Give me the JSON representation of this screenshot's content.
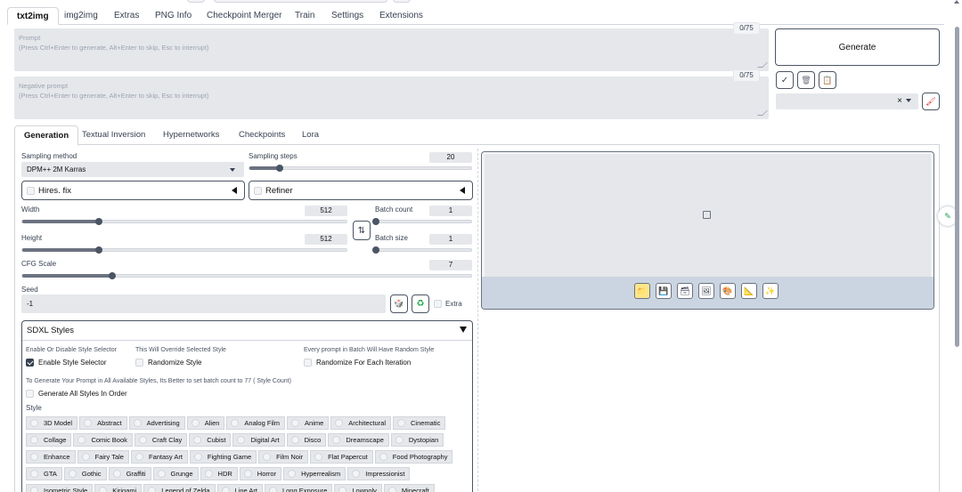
{
  "tabs": [
    "txt2img",
    "img2img",
    "Extras",
    "PNG Info",
    "Checkpoint Merger",
    "Train",
    "Settings",
    "Extensions"
  ],
  "prompt": {
    "label": "Prompt",
    "hint": "(Press Ctrl+Enter to generate, Alt+Enter to skip, Esc to interrupt)",
    "counter": "0/75"
  },
  "negative": {
    "label": "Negative prompt",
    "hint": "(Press Ctrl+Enter to generate, Alt+Enter to skip, Esc to interrupt)",
    "counter": "0/75"
  },
  "generate_label": "Generate",
  "tool_icons": {
    "check": "✓",
    "trash": "🗑",
    "clipboard": "📋",
    "clear": "×",
    "paint": "🖌"
  },
  "subtabs": [
    "Generation",
    "Textual Inversion",
    "Hypernetworks",
    "Checkpoints",
    "Lora"
  ],
  "sampling": {
    "method_label": "Sampling method",
    "method_value": "DPM++ 2M Karras",
    "steps_label": "Sampling steps",
    "steps_value": "20",
    "steps_fraction": 0.135
  },
  "hires_label": "Hires. fix",
  "refiner_label": "Refiner",
  "width": {
    "label": "Width",
    "value": "512",
    "fraction": 0.235
  },
  "height": {
    "label": "Height",
    "value": "512",
    "fraction": 0.235
  },
  "swap_icon": "⇅",
  "batch_count": {
    "label": "Batch count",
    "value": "1",
    "fraction": 0.0
  },
  "batch_size": {
    "label": "Batch size",
    "value": "1",
    "fraction": 0.0
  },
  "cfg": {
    "label": "CFG Scale",
    "value": "7",
    "fraction": 0.2
  },
  "seed": {
    "label": "Seed",
    "value": "-1",
    "extra_label": "Extra"
  },
  "sdxl": {
    "title": "SDXL Styles",
    "enable_caption": "Enable Or Disable Style Selector",
    "enable_label": "Enable Style Selector",
    "override_caption": "This Will Override Selected Style",
    "randomize_label": "Randomize Style",
    "batch_caption": "Every prompt in Batch Will Have Random Style",
    "randomize_each_label": "Randomize For Each Iteration",
    "all_caption": "To Generate Your Prompt in All Available Styles, Its Better to set batch count to 77 ( Style Count)",
    "all_label": "Generate All Styles In Order",
    "style_label": "Style",
    "styles": [
      [
        "3D Model",
        "Abstract",
        "Advertising",
        "Alien",
        "Analog Film",
        "Anime",
        "Architectural",
        "Cinematic"
      ],
      [
        "Collage",
        "Comic Book",
        "Craft Clay",
        "Cubist",
        "Digital Art",
        "Disco",
        "Dreamscape",
        "Dystopian"
      ],
      [
        "Enhance",
        "Fairy Tale",
        "Fantasy Art",
        "Fighting Game",
        "Film Noir",
        "Flat Papercut",
        "Food Photography"
      ],
      [
        "GTA",
        "Gothic",
        "Graffiti",
        "Grunge",
        "HDR",
        "Horror",
        "Hyperrealism",
        "Impressionist"
      ],
      [
        "Isometric Style",
        "Kirigami",
        "Legend of Zelda",
        "Line Art",
        "Long Exposure",
        "Lowpoly",
        "Minecraft"
      ]
    ]
  },
  "output_icons": [
    "folder-icon",
    "save-icon",
    "zip-icon",
    "image-icon",
    "palette-icon",
    "ruler-icon",
    "sparkle-icon"
  ],
  "colors": {
    "accent": "#f97316",
    "panel_border": "#d1d5db",
    "output_bg": "#e5e7eb"
  }
}
